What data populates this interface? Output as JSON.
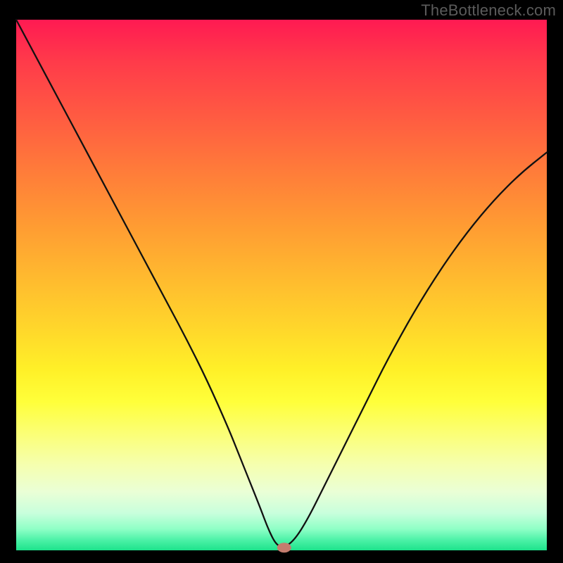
{
  "attribution": "TheBottleneck.com",
  "chart_data": {
    "type": "line",
    "title": "",
    "xlabel": "",
    "ylabel": "",
    "xlim": [
      0,
      100
    ],
    "ylim": [
      0,
      100
    ],
    "series": [
      {
        "name": "bottleneck-curve",
        "x": [
          0,
          4,
          8,
          12,
          16,
          20,
          24,
          28,
          32,
          36,
          40,
          42,
          44,
          46,
          47.5,
          49,
          50.5,
          52.5,
          55,
          58,
          62,
          66,
          70,
          75,
          80,
          85,
          90,
          95,
          100
        ],
        "y": [
          100,
          92.5,
          85,
          77.5,
          70,
          62.5,
          55,
          47.5,
          40,
          32,
          23,
          18,
          13,
          8,
          4,
          1,
          0.5,
          2,
          6,
          12,
          20,
          28,
          36,
          45,
          53,
          60,
          66,
          71,
          75
        ]
      }
    ],
    "marker": {
      "x": 50.5,
      "y": 0.5,
      "label": "optimal-point"
    },
    "colors": {
      "curve": "#111111",
      "marker": "#c47c6e",
      "gradient_top": "#ff1a52",
      "gradient_mid": "#ffff3a",
      "gradient_bottom": "#1de28b"
    }
  }
}
